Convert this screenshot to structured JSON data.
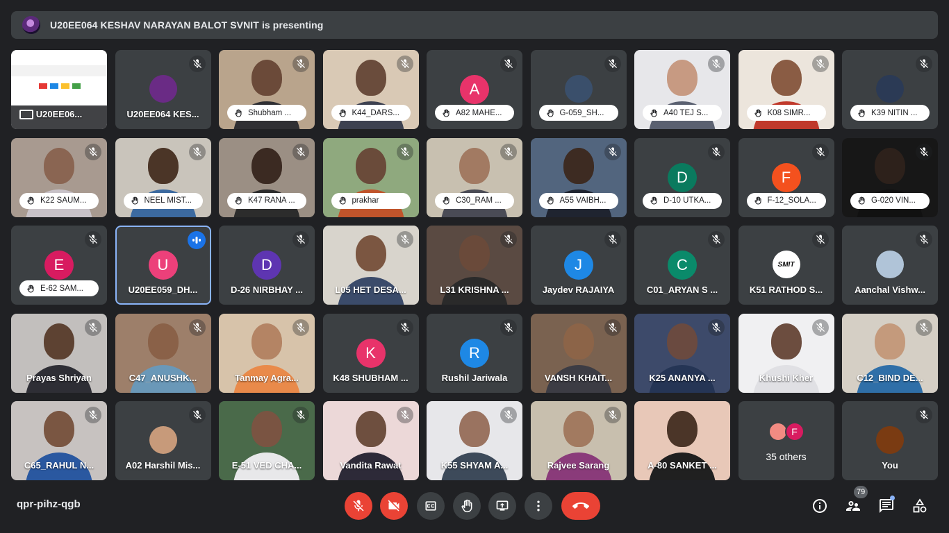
{
  "banner": {
    "text": "U20EE064 KESHAV NARAYAN BALOT SVNIT is presenting"
  },
  "meeting_code": "qpr-pihz-qgb",
  "participant_count": "79",
  "colors": {
    "mute_red": "#ea4335",
    "speaking_outline": "#8ab4f8",
    "tile_bg": "#3c4043",
    "page_bg": "#202124"
  },
  "tiles": [
    {
      "kind": "screen",
      "label": "U20EE06...",
      "muted": false
    },
    {
      "kind": "photo",
      "label": "U20EE064 KES...",
      "muted": true,
      "photo_color": "#6a2b85"
    },
    {
      "kind": "video",
      "label": "Shubham ...",
      "hand": true,
      "muted": true,
      "bg": "#b9a48c",
      "skin": "#6b4a39",
      "shirt": "#2f2f33"
    },
    {
      "kind": "video",
      "label": "K44_DARS...",
      "hand": true,
      "muted": true,
      "bg": "#d9c9b5",
      "skin": "#6a4c3c",
      "shirt": "#3d4150"
    },
    {
      "kind": "avatar",
      "label": "A82 MAHE...",
      "hand": true,
      "muted": true,
      "letter": "A",
      "color": "#e8336a"
    },
    {
      "kind": "photo",
      "label": "G-059_SH...",
      "hand": true,
      "muted": true,
      "photo_color": "#3a4f6b"
    },
    {
      "kind": "video",
      "label": "A40 TEJ S...",
      "hand": true,
      "muted": true,
      "bg": "#e7e7ea",
      "skin": "#c79a82",
      "shirt": "#5a6070"
    },
    {
      "kind": "video",
      "label": "K08 SIMR...",
      "hand": true,
      "muted": true,
      "bg": "#ece5dc",
      "skin": "#8a5c44",
      "shirt": "#c0392b"
    },
    {
      "kind": "photo",
      "label": "K39 NITIN ...",
      "hand": true,
      "muted": true,
      "photo_color": "#2b3a55"
    },
    {
      "kind": "video",
      "label": "K22 SAUM...",
      "hand": true,
      "muted": true,
      "bg": "#a89a90",
      "skin": "#8a6552",
      "shirt": "#c8c2c8"
    },
    {
      "kind": "video",
      "label": "NEEL MIST...",
      "hand": true,
      "muted": true,
      "bg": "#c9c4bb",
      "skin": "#4b3527",
      "shirt": "#3c6aa0"
    },
    {
      "kind": "video",
      "label": "K47 RANA ...",
      "hand": true,
      "muted": true,
      "bg": "#9b8f84",
      "skin": "#3b2a22",
      "shirt": "#2c2c2c"
    },
    {
      "kind": "video",
      "label": "prakhar",
      "hand": true,
      "muted": true,
      "bg": "#8fa97e",
      "skin": "#6a4b3a",
      "shirt": "#c0542b"
    },
    {
      "kind": "video",
      "label": "C30_RAM ...",
      "hand": true,
      "muted": true,
      "bg": "#c8c0b0",
      "skin": "#a27a62",
      "shirt": "#4a4b55"
    },
    {
      "kind": "video",
      "label": "A55 VAIBH...",
      "hand": true,
      "muted": true,
      "bg": "#52657e",
      "skin": "#3d2b22",
      "shirt": "#1f2430"
    },
    {
      "kind": "avatar",
      "label": "D-10 UTKA...",
      "hand": true,
      "muted": true,
      "letter": "D",
      "color": "#0a7a5e"
    },
    {
      "kind": "avatar",
      "label": "F-12_SOLA...",
      "hand": true,
      "muted": true,
      "letter": "F",
      "color": "#f4511e"
    },
    {
      "kind": "video",
      "label": "G-020 VIN...",
      "hand": true,
      "muted": true,
      "bg": "#171717",
      "skin": "#2d211b",
      "shirt": "#111111"
    },
    {
      "kind": "avatar",
      "label": "E-62 SAM...",
      "hand": true,
      "muted": true,
      "letter": "E",
      "color": "#d81b60"
    },
    {
      "kind": "avatar",
      "label": "U20EE059_DH...",
      "hand": false,
      "muted": false,
      "speaking": true,
      "letter": "U",
      "color": "#ec407a"
    },
    {
      "kind": "avatar",
      "label": "D-26 NIRBHAY ...",
      "hand": false,
      "muted": true,
      "letter": "D",
      "color": "#5e35b1"
    },
    {
      "kind": "video",
      "label": "L05 HET DESA...",
      "hand": false,
      "muted": true,
      "bg": "#d8d4cc",
      "skin": "#7b5641",
      "shirt": "#3b4b6a"
    },
    {
      "kind": "video",
      "label": "L31 KRISHNA ...",
      "hand": false,
      "muted": true,
      "bg": "#5a4a42",
      "skin": "#6a4a3a",
      "shirt": "#2a2a2a"
    },
    {
      "kind": "avatar",
      "label": "Jaydev RAJAIYA",
      "hand": false,
      "muted": true,
      "letter": "J",
      "color": "#1e88e5"
    },
    {
      "kind": "avatar",
      "label": "C01_ARYAN S ...",
      "hand": false,
      "muted": true,
      "letter": "C",
      "color": "#0a8a6a"
    },
    {
      "kind": "photo",
      "label": "K51 RATHOD S...",
      "hand": false,
      "muted": true,
      "photo_color": "#ffffff",
      "photo_text": "SMIT"
    },
    {
      "kind": "photo",
      "label": "Aanchal Vishw...",
      "hand": false,
      "muted": true,
      "photo_color": "#b0c4d8"
    },
    {
      "kind": "video",
      "label": "Prayas Shriyan",
      "hand": false,
      "muted": true,
      "bg": "#c2bfbd",
      "skin": "#5d4232",
      "shirt": "#2e2e35"
    },
    {
      "kind": "video",
      "label": "C47_ANUSHK...",
      "hand": false,
      "muted": true,
      "bg": "#9d7f6a",
      "skin": "#8a6148",
      "shirt": "#6a98b8"
    },
    {
      "kind": "video",
      "label": "Tanmay Agra...",
      "hand": false,
      "muted": true,
      "bg": "#d7c3aa",
      "skin": "#b48464",
      "shirt": "#e98a4a"
    },
    {
      "kind": "avatar",
      "label": "K48 SHUBHAM ...",
      "hand": false,
      "muted": true,
      "letter": "K",
      "color": "#e8336a"
    },
    {
      "kind": "avatar",
      "label": "Rushil Jariwala",
      "hand": false,
      "muted": true,
      "letter": "R",
      "color": "#1e88e5"
    },
    {
      "kind": "video",
      "label": "VANSH KHAIT...",
      "hand": false,
      "muted": true,
      "bg": "#7a6250",
      "skin": "#8c6448",
      "shirt": "#3c3c44"
    },
    {
      "kind": "video",
      "label": "K25 ANANYA ...",
      "hand": false,
      "muted": true,
      "bg": "#3d4a6a",
      "skin": "#6a4a40",
      "shirt": "#253555"
    },
    {
      "kind": "video",
      "label": "Khushi Kher",
      "hand": false,
      "muted": true,
      "bg": "#f0f0f2",
      "skin": "#6c4d3f",
      "shirt": "#e0e0e4"
    },
    {
      "kind": "video",
      "label": "C12_BIND DE...",
      "hand": false,
      "muted": true,
      "bg": "#d5cfc5",
      "skin": "#c49a7c",
      "shirt": "#2f6fa8"
    },
    {
      "kind": "video",
      "label": "C65_RAHUL N...",
      "hand": false,
      "muted": true,
      "bg": "#c7c2c0",
      "skin": "#7a5642",
      "shirt": "#2a58a0"
    },
    {
      "kind": "photo",
      "label": "A02 Harshil Mis...",
      "hand": false,
      "muted": true,
      "photo_color": "#c79a7a"
    },
    {
      "kind": "video",
      "label": "E-51 VED CHA...",
      "hand": false,
      "muted": true,
      "bg": "#4a6a4a",
      "skin": "#7a5442",
      "shirt": "#e8e8ea"
    },
    {
      "kind": "video",
      "label": "Vandita Rawat",
      "hand": false,
      "muted": true,
      "bg": "#ecd8d8",
      "skin": "#6e4f3f",
      "shirt": "#2d2a38"
    },
    {
      "kind": "video",
      "label": "K55 SHYAM A...",
      "hand": false,
      "muted": true,
      "bg": "#e7e7ea",
      "skin": "#9a7360",
      "shirt": "#3d4a5a"
    },
    {
      "kind": "video",
      "label": "Rajvee Sarang",
      "hand": false,
      "muted": true,
      "bg": "#c8bfae",
      "skin": "#a27a60",
      "shirt": "#8a3b7a"
    },
    {
      "kind": "video",
      "label": "A-80 SANKET ...",
      "hand": false,
      "muted": false,
      "bg": "#e8c8b8",
      "skin": "#4b3528",
      "shirt": "#202020"
    },
    {
      "kind": "others",
      "label": "35 others",
      "letter": "F"
    },
    {
      "kind": "photo",
      "label": "You",
      "hand": false,
      "muted": true,
      "photo_color": "#7a3b12"
    }
  ],
  "controls": {
    "mic": "microphone-off",
    "cam": "camera-off",
    "cc": "captions",
    "hand": "raise-hand",
    "present": "present-now",
    "more": "more-options",
    "end": "leave-call"
  },
  "right_controls": [
    "info",
    "people",
    "chat",
    "activities"
  ]
}
